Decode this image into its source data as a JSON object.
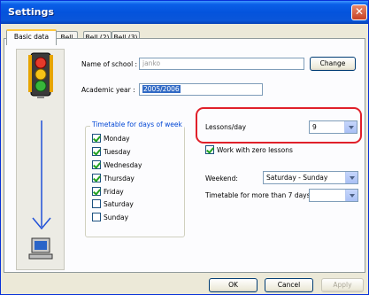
{
  "window": {
    "title": "Settings"
  },
  "tabs": [
    {
      "label": "Basic data"
    },
    {
      "label": "Bell"
    },
    {
      "label": "Bell (2)"
    },
    {
      "label": "Bell (3)"
    }
  ],
  "school": {
    "label": "Name of school :",
    "value": "janko",
    "change_label": "Change"
  },
  "academic_year": {
    "label": "Academic year :",
    "value": "2005/2006"
  },
  "timetable_days": {
    "title": "Timetable for days of week",
    "days": [
      {
        "label": "Monday",
        "checked": true
      },
      {
        "label": "Tuesday",
        "checked": true
      },
      {
        "label": "Wednesday",
        "checked": true
      },
      {
        "label": "Thursday",
        "checked": true
      },
      {
        "label": "Friday",
        "checked": true
      },
      {
        "label": "Saturday",
        "checked": false
      },
      {
        "label": "Sunday",
        "checked": false
      }
    ]
  },
  "lessons": {
    "label": "Lessons/day",
    "value": "9"
  },
  "zero_lessons": {
    "label": "Work with zero lessons",
    "checked": true
  },
  "weekend": {
    "label": "Weekend:",
    "value": "Saturday - Sunday"
  },
  "timetable_more": {
    "label": "Timetable for more than 7 days",
    "value": ""
  },
  "footer": {
    "ok": "OK",
    "cancel": "Cancel",
    "apply": "Apply"
  },
  "colors": {
    "highlight": "#e0202a",
    "titlebar": "#0453dc"
  }
}
